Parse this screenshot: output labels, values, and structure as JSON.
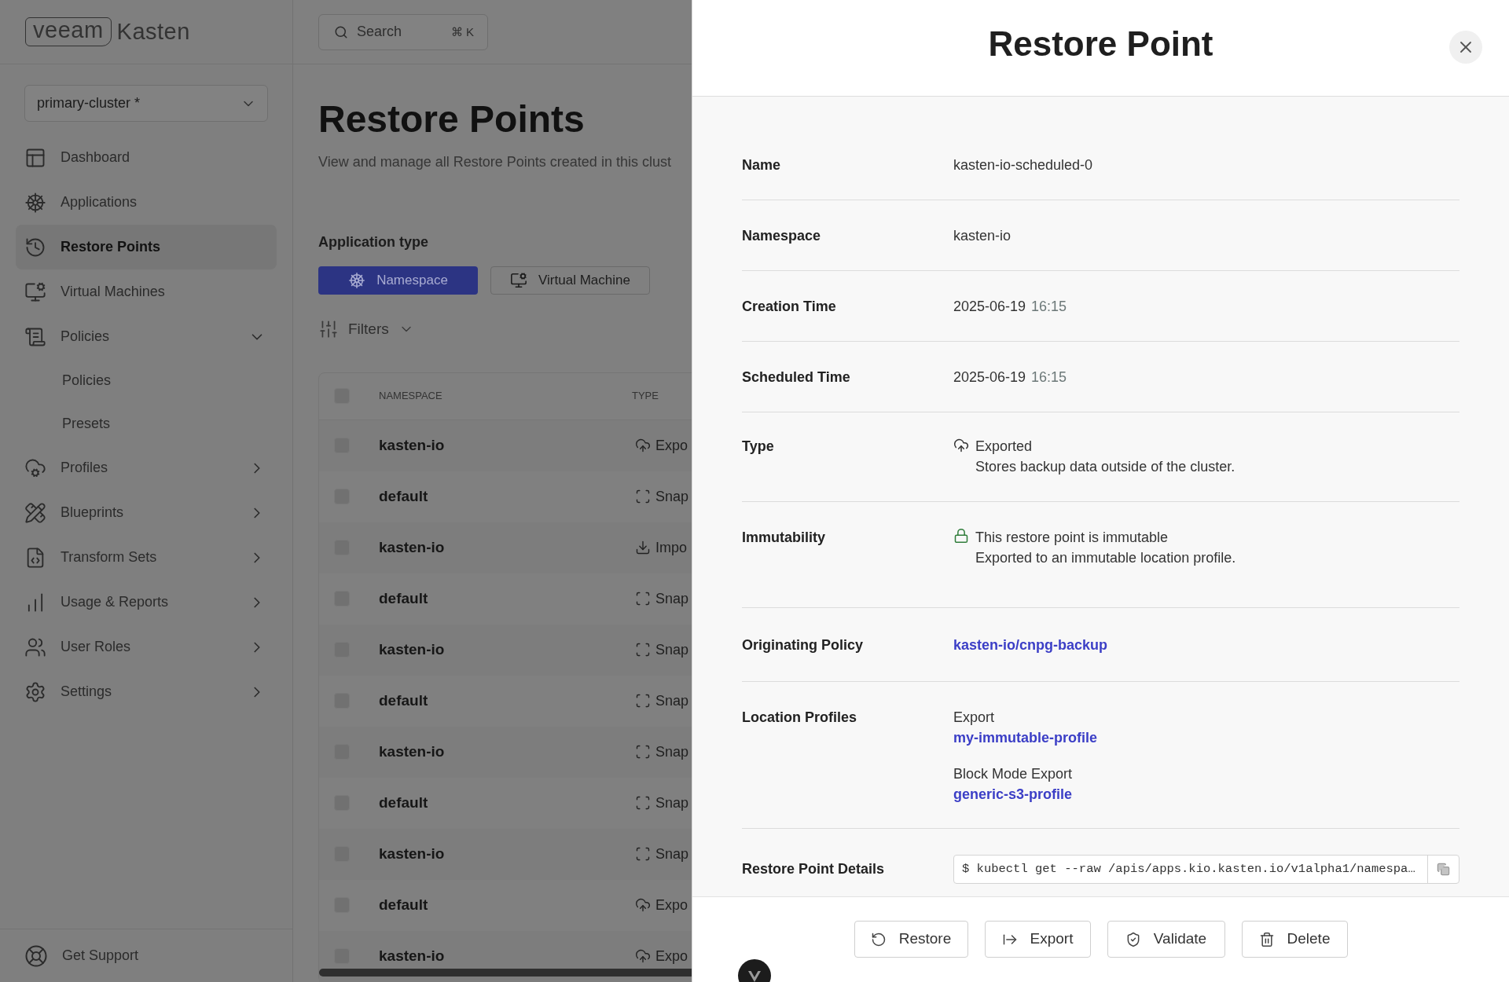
{
  "sidebar": {
    "logo": {
      "brand": "veeam",
      "product": "Kasten"
    },
    "cluster_select": {
      "value": "primary-cluster *"
    },
    "items": [
      {
        "label": "Dashboard",
        "selected": false
      },
      {
        "label": "Applications",
        "selected": false
      },
      {
        "label": "Restore Points",
        "selected": true
      },
      {
        "label": "Virtual Machines",
        "selected": false
      },
      {
        "label": "Policies",
        "selected": false,
        "expanded": true,
        "children": [
          {
            "label": "Policies",
            "selected": false
          },
          {
            "label": "Presets",
            "selected": false
          }
        ]
      },
      {
        "label": "Profiles",
        "selected": false,
        "expanded": false
      },
      {
        "label": "Blueprints",
        "selected": false,
        "expanded": false
      },
      {
        "label": "Transform Sets",
        "selected": false,
        "expanded": false
      },
      {
        "label": "Usage & Reports",
        "selected": false,
        "expanded": false
      },
      {
        "label": "User Roles",
        "selected": false,
        "expanded": false
      },
      {
        "label": "Settings",
        "selected": false,
        "expanded": false
      }
    ],
    "footer_link": "Get Support"
  },
  "main": {
    "search": {
      "placeholder": "Search",
      "shortcut": "⌘ K"
    },
    "title": "Restore Points",
    "subtitle": "View and manage all Restore Points created in this clust",
    "app_type": {
      "label": "Application type",
      "options": [
        {
          "label": "Namespace",
          "selected": true
        },
        {
          "label": "Virtual Machine",
          "selected": false
        }
      ]
    },
    "filters": {
      "label": "Filters"
    },
    "table": {
      "select_all_checked": false,
      "columns": [
        "NAMESPACE",
        "TYPE"
      ],
      "rows": [
        {
          "namespace": "kasten-io",
          "kind": "export",
          "type": "Expo",
          "checked": false
        },
        {
          "namespace": "default",
          "kind": "snapshot",
          "type": "Snap",
          "checked": false
        },
        {
          "namespace": "kasten-io",
          "kind": "import",
          "type": "Impo",
          "checked": false
        },
        {
          "namespace": "default",
          "kind": "snapshot",
          "type": "Snap",
          "checked": false
        },
        {
          "namespace": "kasten-io",
          "kind": "snapshot",
          "type": "Snap",
          "checked": false
        },
        {
          "namespace": "default",
          "kind": "snapshot",
          "type": "Snap",
          "checked": false
        },
        {
          "namespace": "kasten-io",
          "kind": "snapshot",
          "type": "Snap",
          "checked": false
        },
        {
          "namespace": "default",
          "kind": "snapshot",
          "type": "Snap",
          "checked": false
        },
        {
          "namespace": "kasten-io",
          "kind": "snapshot",
          "type": "Snap",
          "checked": false
        },
        {
          "namespace": "default",
          "kind": "export",
          "type": "Expo",
          "checked": false
        },
        {
          "namespace": "kasten-io",
          "kind": "export",
          "type": "Expo",
          "checked": false
        }
      ]
    }
  },
  "restore_point_panel": {
    "title": "Restore Point",
    "fields": [
      {
        "kind": "text",
        "label": "Name",
        "value": "kasten-io-scheduled-0"
      },
      {
        "kind": "text",
        "label": "Namespace",
        "value": "kasten-io"
      },
      {
        "kind": "datetime",
        "label": "Creation Time",
        "date": "2025-06-19",
        "time": "16:15"
      },
      {
        "kind": "datetime",
        "label": "Scheduled Time",
        "date": "2025-06-19",
        "time": "16:15"
      },
      {
        "kind": "type",
        "label": "Type",
        "title": "Exported",
        "description": "Stores backup data outside of the cluster."
      },
      {
        "kind": "immutability",
        "label": "Immutability",
        "title": "This restore point is immutable",
        "description": "Exported to an immutable location profile."
      },
      {
        "kind": "link",
        "label": "Originating Policy",
        "value": "kasten-io/cnpg-backup"
      },
      {
        "kind": "profiles",
        "label": "Location Profiles",
        "profiles": [
          {
            "label": "Export",
            "link": "my-immutable-profile"
          },
          {
            "label": "Block Mode Export",
            "link": "generic-s3-profile"
          }
        ]
      },
      {
        "kind": "command",
        "label": "Restore Point Details",
        "value": "$ kubectl get --raw /apis/apps.kio.kasten.io/v1alpha1/namespa…"
      }
    ],
    "actions": [
      "Restore",
      "Export",
      "Validate",
      "Delete"
    ]
  }
}
